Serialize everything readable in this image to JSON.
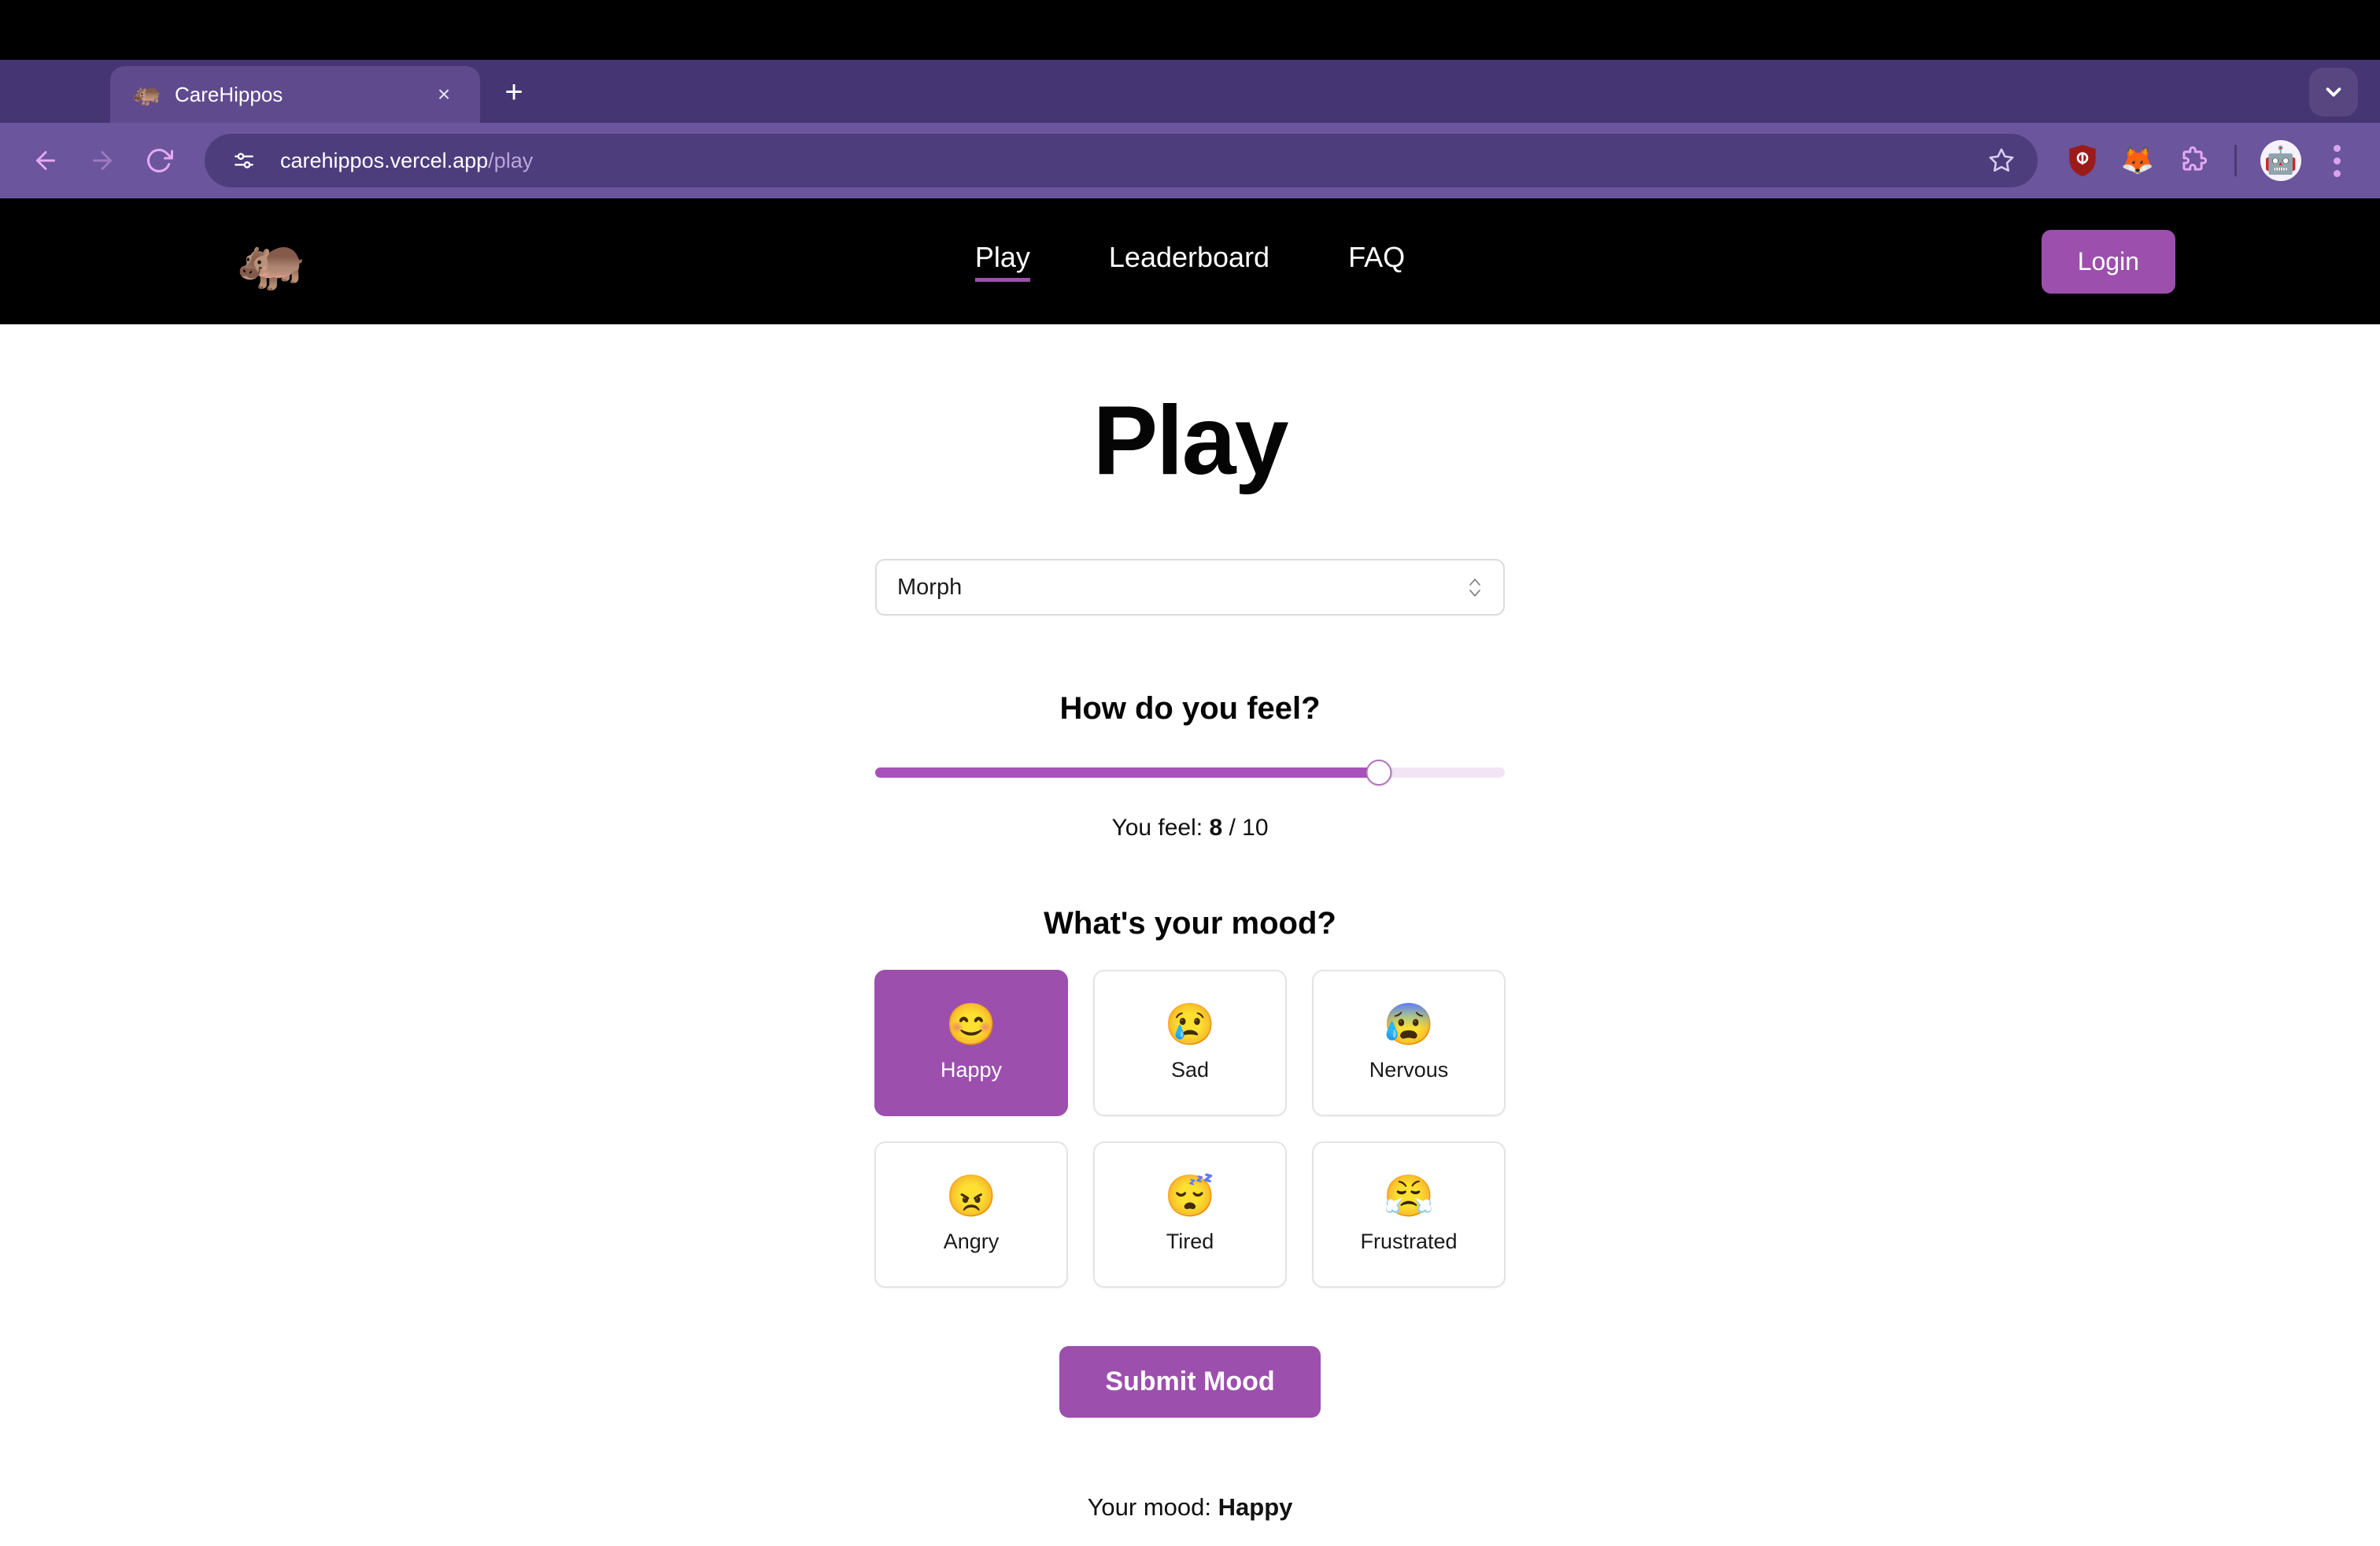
{
  "browser": {
    "tab": {
      "favicon": "hippo-favicon",
      "title": "CareHippos",
      "close_label": "×"
    },
    "new_tab_label": "+",
    "tab_search_icon": "chevron-down-icon",
    "nav": {
      "back_icon": "back-arrow-icon",
      "forward_icon": "forward-arrow-icon",
      "reload_icon": "reload-icon"
    },
    "omnibox": {
      "site_info_icon": "site-settings-icon",
      "url_host": "carehippos.vercel.app",
      "url_path": "/play",
      "bookmark_icon": "star-icon"
    },
    "extensions": [
      {
        "name": "ublock-origin-icon",
        "glyph": "🛡"
      },
      {
        "name": "metamask-icon",
        "glyph": "🦊"
      },
      {
        "name": "extensions-puzzle-icon",
        "glyph": "🧩"
      }
    ],
    "profile_icon": "profile-avatar",
    "menu_icon": "three-dot-menu-icon"
  },
  "site": {
    "logo": "hippo-logo",
    "nav_items": [
      {
        "label": "Play",
        "active": true
      },
      {
        "label": "Leaderboard",
        "active": false
      },
      {
        "label": "FAQ",
        "active": false
      }
    ],
    "login_label": "Login"
  },
  "main": {
    "title": "Play",
    "mode_select": {
      "value": "Morph",
      "options": [
        "Morph"
      ]
    },
    "feel": {
      "heading": "How do you feel?",
      "slider_value": 8,
      "slider_min": 0,
      "slider_max": 10,
      "slider_percent": 80,
      "value_prefix": "You feel:",
      "value_number": "8",
      "value_suffix": "/ 10"
    },
    "mood": {
      "heading": "What's your mood?",
      "options": [
        {
          "label": "Happy",
          "emoji": "😊",
          "selected": true
        },
        {
          "label": "Sad",
          "emoji": "😢",
          "selected": false
        },
        {
          "label": "Nervous",
          "emoji": "😰",
          "selected": false
        },
        {
          "label": "Angry",
          "emoji": "😠",
          "selected": false
        },
        {
          "label": "Tired",
          "emoji": "😴",
          "selected": false
        },
        {
          "label": "Frustrated",
          "emoji": "😤",
          "selected": false
        }
      ]
    },
    "submit_label": "Submit Mood",
    "result": {
      "prefix": "Your mood:",
      "value": "Happy"
    }
  },
  "colors": {
    "accent_purple": "#9c4fad",
    "slider_fill": "#a850bb",
    "slider_track": "#f2e4f5",
    "header_black": "#000000",
    "chrome_tabstrip": "#453572",
    "chrome_toolbar": "#6b559c",
    "chrome_omnibox": "#4e3d7d"
  }
}
